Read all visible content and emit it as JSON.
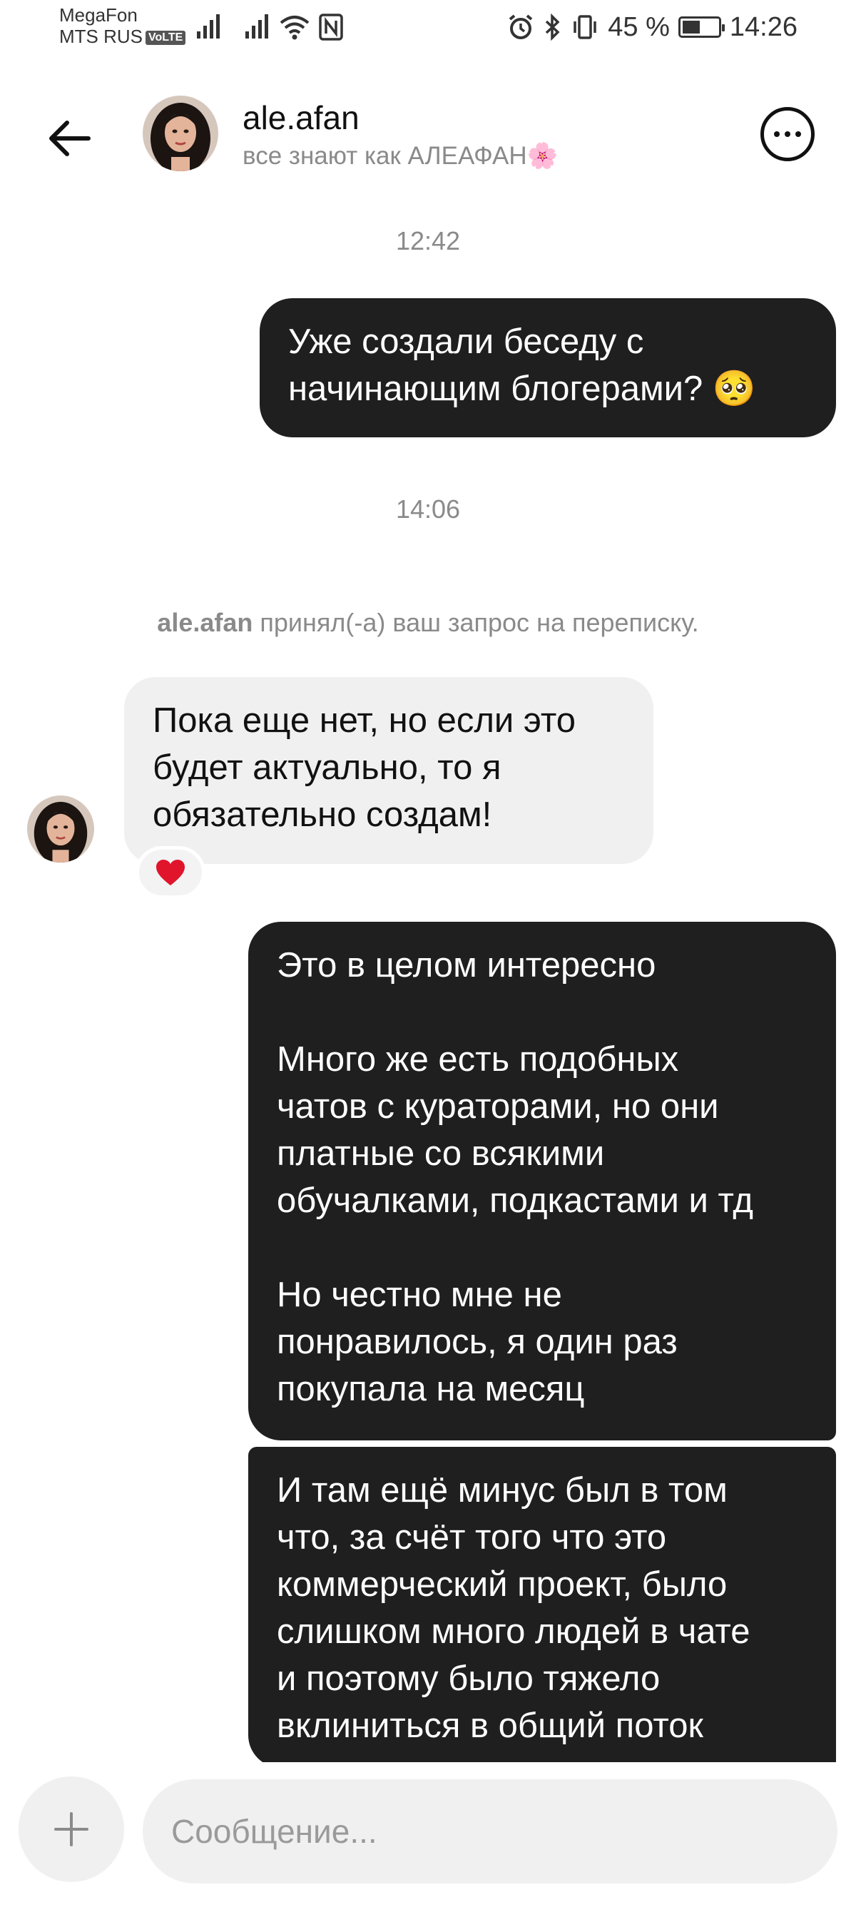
{
  "status_bar": {
    "carrier_1": "MegaFon",
    "carrier_2": "MTS RUS",
    "volte_badge": "VoLTE",
    "battery_percent": "45 %",
    "battery_level": 0.45,
    "time": "14:26"
  },
  "header": {
    "name": "ale.afan",
    "subtitle": "все знают как АЛЕАФАН🌸",
    "back_icon": "arrow-left-icon",
    "more_icon": "more-horizontal-icon"
  },
  "messages": {
    "ts_1": "12:42",
    "msg_out_1": "Уже создали беседу с\nначинающим блогерами? 🥺",
    "ts_2": "14:06",
    "system_user": "ale.afan",
    "system_text": " принял(-а) ваш запрос на переписку.",
    "msg_in_1": "Пока еще нет, но если это\nбудет актуально, то я\nобязательно создам!",
    "reaction": "❤️",
    "msg_out_2": "Это в целом интересно\n\nМного же есть подобных\nчатов с кураторами, но они\nплатные со всякими\nобучалками, подкастами и тд\n\nНо честно мне не\nпонравилось, я один раз\nпокупала на месяц",
    "msg_out_3": "И там ещё минус был в том\nчто, за счёт того что это\nкоммерческий проект, было\nслишком много людей в чате\nи поэтому было тяжело\nвклиниться в общий поток"
  },
  "composer": {
    "placeholder": "Сообщение...",
    "plus_icon": "plus-icon"
  },
  "colors": {
    "outgoing_bubble": "#1f1f1f",
    "incoming_bubble": "#f0f0f0",
    "muted_text": "#8a8a8a"
  }
}
